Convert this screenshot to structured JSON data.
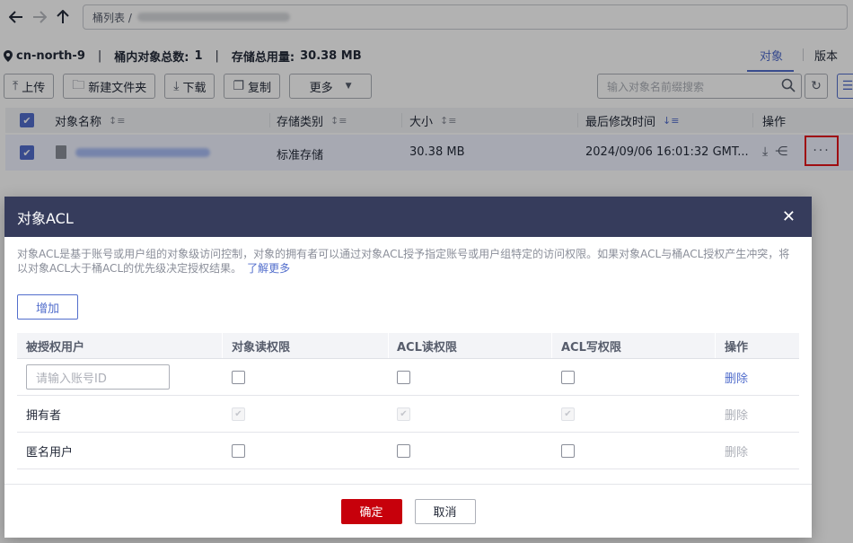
{
  "nav": {
    "back_icon": "arrow-left-icon",
    "forward_icon": "arrow-right-icon",
    "up_icon": "arrow-up-icon",
    "breadcrumb_root": "桶列表 /"
  },
  "info": {
    "region": "cn-north-9",
    "object_count_label": "桶内对象总数:",
    "object_count": "1",
    "storage_label": "存储总用量:",
    "storage_value": "30.38 MB"
  },
  "tabs": {
    "objects": "对象",
    "versions": "版本"
  },
  "toolbar": {
    "upload": "上传",
    "new_folder": "新建文件夹",
    "download": "下载",
    "copy": "复制",
    "more": "更多",
    "search_placeholder": "输入对象名前缀搜索"
  },
  "table": {
    "headers": [
      "对象名称",
      "存储类别",
      "大小",
      "最后修改时间",
      "操作"
    ],
    "row": {
      "storage_class": "标准存储",
      "size": "30.38 MB",
      "modified": "2024/09/06 16:01:32 GMT...",
      "more": "···"
    }
  },
  "modal": {
    "title": "对象ACL",
    "description": "对象ACL是基于账号或用户组的对象级访问控制，对象的拥有者可以通过对象ACL授予指定账号或用户组特定的访问权限。如果对象ACL与桶ACL授权产生冲突，将以对象ACL大于桶ACL的优先级决定授权结果。",
    "learn_more": "了解更多",
    "add": "增加",
    "columns": [
      "被授权用户",
      "对象读权限",
      "ACL读权限",
      "ACL写权限",
      "操作"
    ],
    "id_placeholder": "请输入账号ID",
    "rows": [
      {
        "user": "",
        "delete": "删除"
      },
      {
        "user": "拥有者",
        "delete": "删除"
      },
      {
        "user": "匿名用户",
        "delete": "删除"
      }
    ],
    "ok": "确定",
    "cancel": "取消"
  }
}
